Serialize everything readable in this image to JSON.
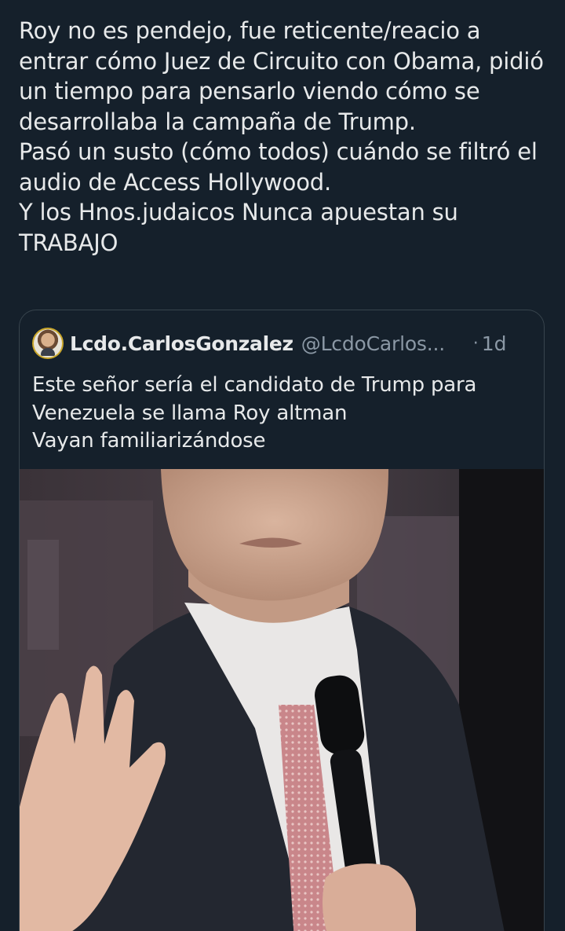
{
  "tweet": {
    "text": "Roy no es pendejo, fue reticente/reacio a entrar cómo Juez de Circuito con Obama, pidió un tiempo para pensarlo viendo cómo se desarrollaba la campaña de Trump.\nPasó un susto (cómo todos) cuándo se filtró el audio de Access Hollywood.\nY los Hnos.judaicos Nunca apuestan su TRABAJO"
  },
  "quote": {
    "display_name": "Lcdo.CarlosGonzalez",
    "handle": "@LcdoCarlos...",
    "separator": "·",
    "time": "1d",
    "text": "Este señor sería el candidato de Trump para Venezuela se llama Roy altman\nVayan familiarizándose"
  },
  "colors": {
    "background": "#15202b",
    "text": "#e7e9ea",
    "secondary_text": "#8b98a5",
    "border": "#38444d"
  }
}
